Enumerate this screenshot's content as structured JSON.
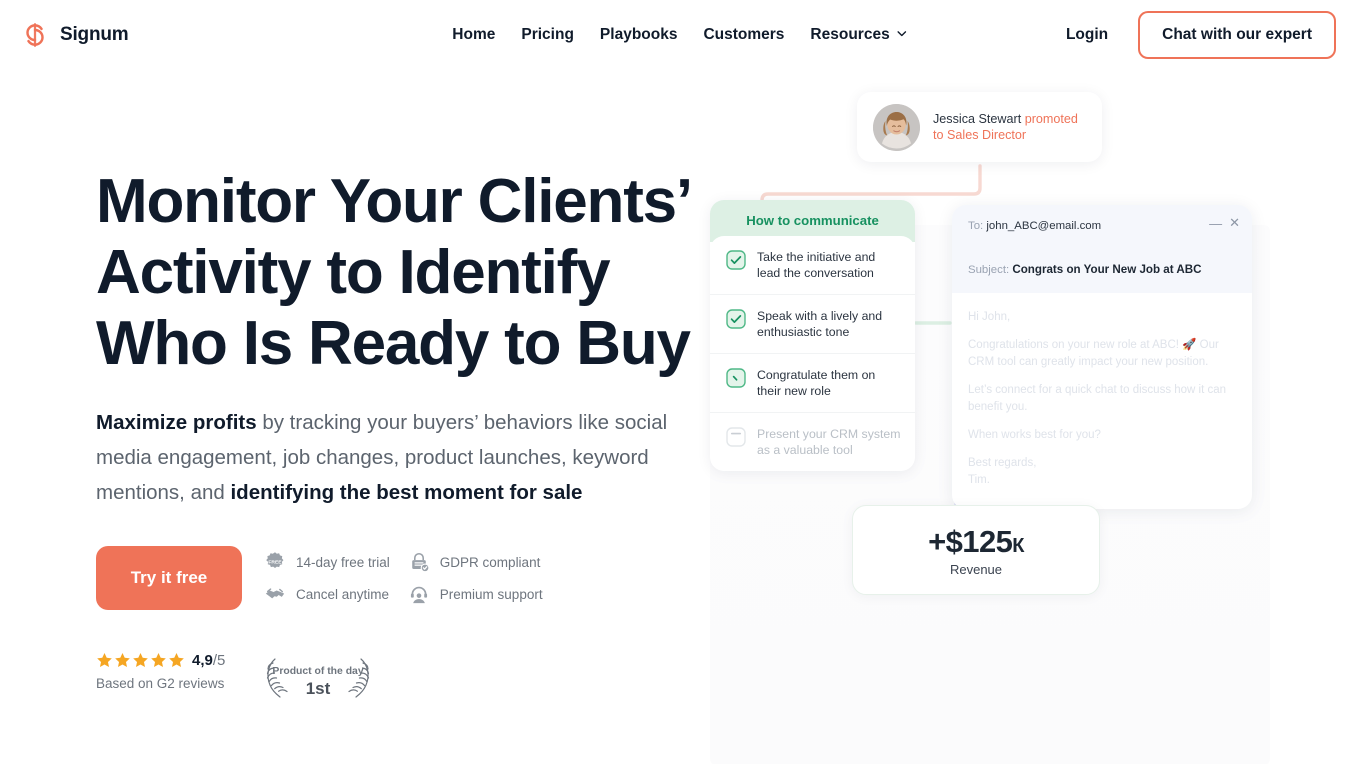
{
  "brand": {
    "name": "Signum",
    "logo_icon": "signum-s-logo",
    "color": "#ef7358"
  },
  "nav": {
    "links": [
      {
        "label": "Home",
        "icon": null
      },
      {
        "label": "Pricing",
        "icon": null
      },
      {
        "label": "Playbooks",
        "icon": null
      },
      {
        "label": "Customers",
        "icon": null
      },
      {
        "label": "Resources",
        "icon": "chevron-down-icon"
      }
    ],
    "login_label": "Login",
    "cta_label": "Chat with our expert"
  },
  "hero": {
    "headline": "Monitor Your Clients’ Activity to Identify Who Is Ready to Buy",
    "sub_bold_lead": "Maximize profits",
    "sub_mid": " by tracking your buyers’ behaviors like social media engagement, job changes, product launches, keyword mentions, and ",
    "sub_bold_tail": "identifying the best moment for sale",
    "cta_label": "Try it free",
    "perks": [
      {
        "label": "14-day free trial",
        "icon": "free-badge-icon"
      },
      {
        "label": "GDPR compliant",
        "icon": "lock-check-icon"
      },
      {
        "label": "Cancel anytime",
        "icon": "handshake-icon"
      },
      {
        "label": "Premium support",
        "icon": "headset-support-icon"
      }
    ],
    "rating": {
      "score": "4,9",
      "out_of": "/5",
      "stars": 5,
      "source": "Based on G2 reviews",
      "star_color": "#f5a623"
    },
    "badge": {
      "title": "Product of the day",
      "rank": "1st",
      "icon": "laurel-wreath-icon"
    }
  },
  "graphic": {
    "notification": {
      "name": "Jessica Stewart",
      "action": "promoted to Sales Director",
      "avatar_icon": "avatar-photo"
    },
    "checklist": {
      "title": "How to communicate",
      "items": [
        {
          "label": "Take the initiative and lead the conversation",
          "checked": true
        },
        {
          "label": "Speak with a lively and enthusiastic tone",
          "checked": true
        },
        {
          "label": "Congratulate them on their new role",
          "checked": true
        },
        {
          "label": "Present your CRM system as a valuable tool",
          "checked": false
        }
      ],
      "accent": "#179160"
    },
    "email": {
      "to_label": "To:",
      "to_value": "john_ABC@email.com",
      "subject_label": "Subject:",
      "subject_value": "Congrats on Your New Job at ABC",
      "minimize_icon": "minimize-icon",
      "close_icon": "close-icon",
      "body": [
        "Hi John,",
        "Congratulations on your  new role at ABC! 🚀 Our CRM  tool can greatly  impact your new position.",
        "Let’s connect for a quick chat to discuss how it can benefit you.",
        "When works best for you?",
        "Best regards,",
        "Tim."
      ]
    },
    "revenue": {
      "value": "+$125",
      "unit": "К",
      "label": "Revenue"
    }
  }
}
